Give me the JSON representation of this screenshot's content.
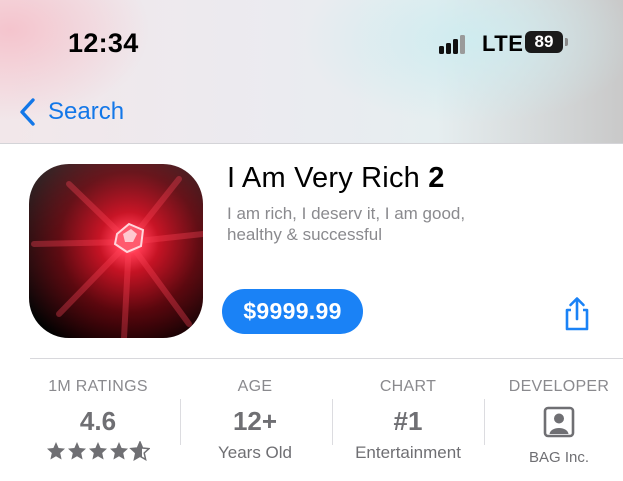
{
  "status_bar": {
    "time": "12:34",
    "network": "LTE",
    "battery_level": "89",
    "signal_bars_active": 3,
    "signal_bars_total": 4
  },
  "nav": {
    "back_label": "Search",
    "back_icon": "chevron-left-icon"
  },
  "app": {
    "title_prefix": "I Am Very Rich",
    "title_number": "2",
    "subtitle": "I am rich, I deserv it, I am good, healthy & successful",
    "price": "$9999.99",
    "share_icon": "share-icon",
    "accent_color": "#1a82f6"
  },
  "stats": {
    "ratings": {
      "label": "1M RATINGS",
      "value": "4.6",
      "stars": 4.6
    },
    "age": {
      "label": "AGE",
      "value": "12+",
      "sub": "Years Old"
    },
    "chart": {
      "label": "CHART",
      "value": "#1",
      "sub": "Entertainment"
    },
    "developer": {
      "label": "DEVELOPER",
      "icon": "person-icon",
      "sub": "BAG Inc."
    }
  }
}
